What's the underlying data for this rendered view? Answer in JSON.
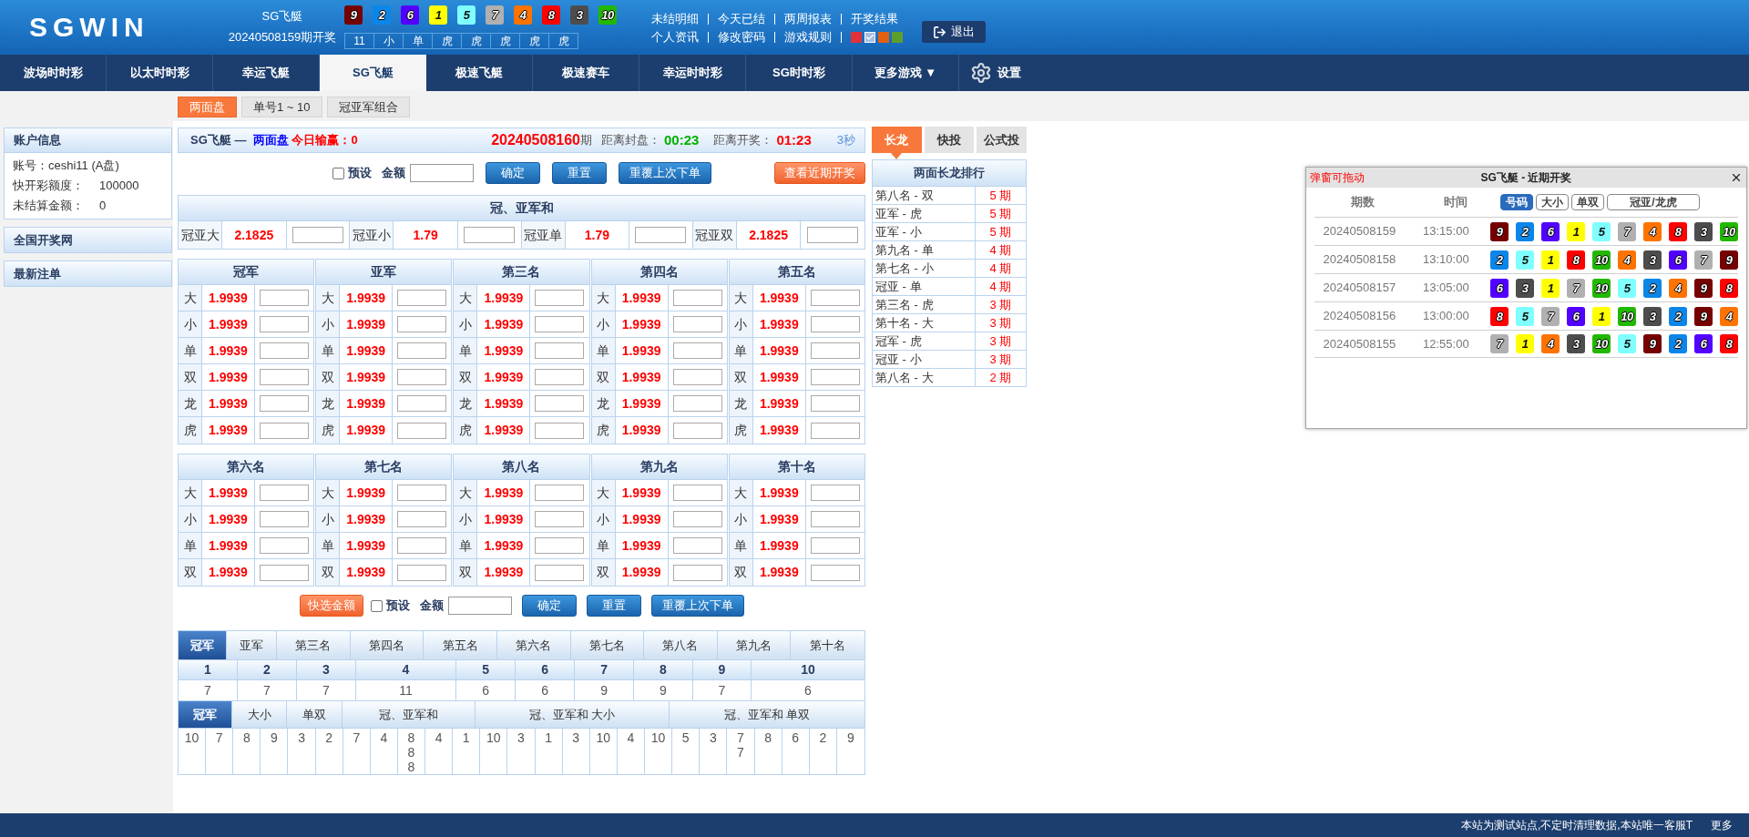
{
  "header": {
    "logo": "SGWIN",
    "game": "SG飞艇",
    "draw_label": "20240508159期开奖",
    "balls": [
      {
        "number": "9",
        "color": "#760000"
      },
      {
        "number": "2",
        "color": "#0b86e8"
      },
      {
        "number": "6",
        "color": "#5200ff"
      },
      {
        "number": "1",
        "color": "#ffff00"
      },
      {
        "number": "5",
        "color": "#80ffff"
      },
      {
        "number": "7",
        "color": "#b0b0b0"
      },
      {
        "number": "4",
        "color": "#ff7300"
      },
      {
        "number": "8",
        "color": "#ff0000"
      },
      {
        "number": "3",
        "color": "#4d4d4d"
      },
      {
        "number": "10",
        "color": "#22b800"
      }
    ],
    "stats": [
      "11",
      "小",
      "单",
      "虎",
      "虎",
      "虎",
      "虎",
      "虎"
    ],
    "links_row_1": [
      "未结明细",
      "今天已结",
      "两周报表",
      "开奖结果"
    ],
    "links_row_2": [
      "个人资讯",
      "修改密码",
      "游戏规则"
    ],
    "themes": [
      {
        "color": "#e0323a",
        "selected": false
      },
      {
        "color": "#a8c0e0",
        "selected": true
      },
      {
        "color": "#e0600f",
        "selected": false
      },
      {
        "color": "#5e9e2c",
        "selected": false
      }
    ],
    "logout": "退出"
  },
  "nav": {
    "items": [
      {
        "label": "波场时时彩",
        "selected": false
      },
      {
        "label": "以太时时彩",
        "selected": false
      },
      {
        "label": "幸运飞艇",
        "selected": false
      },
      {
        "label": "SG飞艇",
        "selected": true
      },
      {
        "label": "极速飞艇",
        "selected": false
      },
      {
        "label": "极速赛车",
        "selected": false
      },
      {
        "label": "幸运时时彩",
        "selected": false
      },
      {
        "label": "SG时时彩",
        "selected": false
      },
      {
        "label": "更多游戏 ▼",
        "selected": false
      }
    ],
    "settings": "设置"
  },
  "subtabs": [
    {
      "label": "两面盘",
      "selected": true
    },
    {
      "label": "单号1 ~ 10",
      "selected": false
    },
    {
      "label": "冠亚军组合",
      "selected": false
    }
  ],
  "sidebar": {
    "account": {
      "title": "账户信息",
      "rows": [
        {
          "kind": "text",
          "label": "账号：",
          "value": "ceshi11 (A盘)"
        },
        {
          "kind": "amount",
          "label": "快开彩额度：",
          "value": "100000"
        },
        {
          "kind": "amount",
          "label": "未结算金额：",
          "value": "0"
        }
      ]
    },
    "panels": [
      "全国开奖网",
      "最新注单"
    ]
  },
  "title_bar": {
    "game": "SG飞艇 —",
    "mode": "两面盘",
    "today_result": "今日输赢：0",
    "period": "20240508160",
    "period_suffix": "期",
    "close_label": "距离封盘：",
    "close_time": "00:23",
    "draw_label": "距离开奖：",
    "draw_time": "01:23",
    "refresh": "3秒"
  },
  "controls_top": {
    "preset_label": "预设",
    "preset_checked": false,
    "amount_label": "金额",
    "buttons": [
      "确定",
      "重置",
      "重覆上次下单"
    ],
    "recent_button": "查看近期开奖"
  },
  "sum_table": {
    "title": "冠、亚军和",
    "items": [
      {
        "label": "冠亚大",
        "odds": "2.1825"
      },
      {
        "label": "冠亚小",
        "odds": "1.79"
      },
      {
        "label": "冠亚单",
        "odds": "1.79"
      },
      {
        "label": "冠亚双",
        "odds": "2.1825"
      }
    ]
  },
  "positions_1": [
    {
      "title": "冠军",
      "rows": [
        {
          "label": "大",
          "odds": "1.9939"
        },
        {
          "label": "小",
          "odds": "1.9939"
        },
        {
          "label": "单",
          "odds": "1.9939"
        },
        {
          "label": "双",
          "odds": "1.9939"
        },
        {
          "label": "龙",
          "odds": "1.9939"
        },
        {
          "label": "虎",
          "odds": "1.9939"
        }
      ]
    },
    {
      "title": "亚军",
      "rows": [
        {
          "label": "大",
          "odds": "1.9939"
        },
        {
          "label": "小",
          "odds": "1.9939"
        },
        {
          "label": "单",
          "odds": "1.9939"
        },
        {
          "label": "双",
          "odds": "1.9939"
        },
        {
          "label": "龙",
          "odds": "1.9939"
        },
        {
          "label": "虎",
          "odds": "1.9939"
        }
      ]
    },
    {
      "title": "第三名",
      "rows": [
        {
          "label": "大",
          "odds": "1.9939"
        },
        {
          "label": "小",
          "odds": "1.9939"
        },
        {
          "label": "单",
          "odds": "1.9939"
        },
        {
          "label": "双",
          "odds": "1.9939"
        },
        {
          "label": "龙",
          "odds": "1.9939"
        },
        {
          "label": "虎",
          "odds": "1.9939"
        }
      ]
    },
    {
      "title": "第四名",
      "rows": [
        {
          "label": "大",
          "odds": "1.9939"
        },
        {
          "label": "小",
          "odds": "1.9939"
        },
        {
          "label": "单",
          "odds": "1.9939"
        },
        {
          "label": "双",
          "odds": "1.9939"
        },
        {
          "label": "龙",
          "odds": "1.9939"
        },
        {
          "label": "虎",
          "odds": "1.9939"
        }
      ]
    },
    {
      "title": "第五名",
      "rows": [
        {
          "label": "大",
          "odds": "1.9939"
        },
        {
          "label": "小",
          "odds": "1.9939"
        },
        {
          "label": "单",
          "odds": "1.9939"
        },
        {
          "label": "双",
          "odds": "1.9939"
        },
        {
          "label": "龙",
          "odds": "1.9939"
        },
        {
          "label": "虎",
          "odds": "1.9939"
        }
      ]
    }
  ],
  "positions_2": [
    {
      "title": "第六名",
      "rows": [
        {
          "label": "大",
          "odds": "1.9939"
        },
        {
          "label": "小",
          "odds": "1.9939"
        },
        {
          "label": "单",
          "odds": "1.9939"
        },
        {
          "label": "双",
          "odds": "1.9939"
        }
      ]
    },
    {
      "title": "第七名",
      "rows": [
        {
          "label": "大",
          "odds": "1.9939"
        },
        {
          "label": "小",
          "odds": "1.9939"
        },
        {
          "label": "单",
          "odds": "1.9939"
        },
        {
          "label": "双",
          "odds": "1.9939"
        }
      ]
    },
    {
      "title": "第八名",
      "rows": [
        {
          "label": "大",
          "odds": "1.9939"
        },
        {
          "label": "小",
          "odds": "1.9939"
        },
        {
          "label": "单",
          "odds": "1.9939"
        },
        {
          "label": "双",
          "odds": "1.9939"
        }
      ]
    },
    {
      "title": "第九名",
      "rows": [
        {
          "label": "大",
          "odds": "1.9939"
        },
        {
          "label": "小",
          "odds": "1.9939"
        },
        {
          "label": "单",
          "odds": "1.9939"
        },
        {
          "label": "双",
          "odds": "1.9939"
        }
      ]
    },
    {
      "title": "第十名",
      "rows": [
        {
          "label": "大",
          "odds": "1.9939"
        },
        {
          "label": "小",
          "odds": "1.9939"
        },
        {
          "label": "单",
          "odds": "1.9939"
        },
        {
          "label": "双",
          "odds": "1.9939"
        }
      ]
    }
  ],
  "controls_bottom": {
    "quick_button": "快选金额",
    "preset_label": "预设",
    "preset_checked": false,
    "amount_label": "金额",
    "buttons": [
      "确定",
      "重置",
      "重覆上次下单"
    ]
  },
  "stats": {
    "position_tabs": [
      {
        "label": "冠军",
        "selected": true
      },
      {
        "label": "亚军",
        "selected": false
      },
      {
        "label": "第三名",
        "selected": false
      },
      {
        "label": "第四名",
        "selected": false
      },
      {
        "label": "第五名",
        "selected": false
      },
      {
        "label": "第六名",
        "selected": false
      },
      {
        "label": "第七名",
        "selected": false
      },
      {
        "label": "第八名",
        "selected": false
      },
      {
        "label": "第九名",
        "selected": false
      },
      {
        "label": "第十名",
        "selected": false
      }
    ],
    "numbers": [
      "1",
      "2",
      "3",
      "4",
      "5",
      "6",
      "7",
      "8",
      "9",
      "10"
    ],
    "counts": [
      "7",
      "7",
      "7",
      "11",
      "6",
      "6",
      "9",
      "9",
      "7",
      "6"
    ],
    "trend_tabs": [
      {
        "label": "冠军",
        "selected": true
      },
      {
        "label": "大小",
        "selected": false
      },
      {
        "label": "单双",
        "selected": false
      },
      {
        "label": "冠、亚军和",
        "selected": false
      },
      {
        "label": "冠、亚军和 大小",
        "selected": false
      },
      {
        "label": "冠、亚军和 单双",
        "selected": false
      }
    ],
    "trend_columns": [
      [
        "10"
      ],
      [
        "7"
      ],
      [
        "8"
      ],
      [
        "9"
      ],
      [
        "3"
      ],
      [
        "2"
      ],
      [
        "7"
      ],
      [
        "4"
      ],
      [
        "8",
        "8",
        "8"
      ],
      [
        "4"
      ],
      [
        "1"
      ],
      [
        "10"
      ],
      [
        "3"
      ],
      [
        "1"
      ],
      [
        "3"
      ],
      [
        "10"
      ],
      [
        "4"
      ],
      [
        "10"
      ],
      [
        "5"
      ],
      [
        "3"
      ],
      [
        "7",
        "7"
      ],
      [
        "8"
      ],
      [
        "6"
      ],
      [
        "2"
      ],
      [
        "9"
      ]
    ]
  },
  "long_dragon": {
    "tabs": [
      {
        "label": "长龙",
        "selected": true
      },
      {
        "label": "快投",
        "selected": false
      },
      {
        "label": "公式投",
        "selected": false
      }
    ],
    "title": "两面长龙排行",
    "rows": [
      {
        "label": "第八名 - 双",
        "count": "5 期"
      },
      {
        "label": "亚军 - 虎",
        "count": "5 期"
      },
      {
        "label": "亚军 - 小",
        "count": "5 期"
      },
      {
        "label": "第九名 - 单",
        "count": "4 期"
      },
      {
        "label": "第七名 - 小",
        "count": "4 期"
      },
      {
        "label": "冠亚 - 单",
        "count": "4 期"
      },
      {
        "label": "第三名 - 虎",
        "count": "3 期"
      },
      {
        "label": "第十名 - 大",
        "count": "3 期"
      },
      {
        "label": "冠军 - 虎",
        "count": "3 期"
      },
      {
        "label": "冠亚 - 小",
        "count": "3 期"
      },
      {
        "label": "第八名 - 大",
        "count": "2 期"
      }
    ]
  },
  "popup": {
    "hint": "弹窗可拖动",
    "title": "SG飞艇 - 近期开奖",
    "columns": [
      "期数",
      "时间"
    ],
    "tabs": [
      {
        "label": "号码",
        "selected": true
      },
      {
        "label": "大小",
        "selected": false
      },
      {
        "label": "单双",
        "selected": false
      },
      {
        "label": "冠亚/龙虎",
        "selected": false
      }
    ],
    "rows": [
      {
        "period": "20240508159",
        "time": "13:15:00",
        "balls": [
          {
            "number": "9",
            "color": "#760000"
          },
          {
            "number": "2",
            "color": "#0b86e8"
          },
          {
            "number": "6",
            "color": "#5200ff"
          },
          {
            "number": "1",
            "color": "#ffff00"
          },
          {
            "number": "5",
            "color": "#80ffff"
          },
          {
            "number": "7",
            "color": "#b0b0b0"
          },
          {
            "number": "4",
            "color": "#ff7300"
          },
          {
            "number": "8",
            "color": "#ff0000"
          },
          {
            "number": "3",
            "color": "#4d4d4d"
          },
          {
            "number": "10",
            "color": "#22b800"
          }
        ]
      },
      {
        "period": "20240508158",
        "time": "13:10:00",
        "balls": [
          {
            "number": "2",
            "color": "#0b86e8"
          },
          {
            "number": "5",
            "color": "#80ffff"
          },
          {
            "number": "1",
            "color": "#ffff00"
          },
          {
            "number": "8",
            "color": "#ff0000"
          },
          {
            "number": "10",
            "color": "#22b800"
          },
          {
            "number": "4",
            "color": "#ff7300"
          },
          {
            "number": "3",
            "color": "#4d4d4d"
          },
          {
            "number": "6",
            "color": "#5200ff"
          },
          {
            "number": "7",
            "color": "#b0b0b0"
          },
          {
            "number": "9",
            "color": "#760000"
          }
        ]
      },
      {
        "period": "20240508157",
        "time": "13:05:00",
        "balls": [
          {
            "number": "6",
            "color": "#5200ff"
          },
          {
            "number": "3",
            "color": "#4d4d4d"
          },
          {
            "number": "1",
            "color": "#ffff00"
          },
          {
            "number": "7",
            "color": "#b0b0b0"
          },
          {
            "number": "10",
            "color": "#22b800"
          },
          {
            "number": "5",
            "color": "#80ffff"
          },
          {
            "number": "2",
            "color": "#0b86e8"
          },
          {
            "number": "4",
            "color": "#ff7300"
          },
          {
            "number": "9",
            "color": "#760000"
          },
          {
            "number": "8",
            "color": "#ff0000"
          }
        ]
      },
      {
        "period": "20240508156",
        "time": "13:00:00",
        "balls": [
          {
            "number": "8",
            "color": "#ff0000"
          },
          {
            "number": "5",
            "color": "#80ffff"
          },
          {
            "number": "7",
            "color": "#b0b0b0"
          },
          {
            "number": "6",
            "color": "#5200ff"
          },
          {
            "number": "1",
            "color": "#ffff00"
          },
          {
            "number": "10",
            "color": "#22b800"
          },
          {
            "number": "3",
            "color": "#4d4d4d"
          },
          {
            "number": "2",
            "color": "#0b86e8"
          },
          {
            "number": "9",
            "color": "#760000"
          },
          {
            "number": "4",
            "color": "#ff7300"
          }
        ]
      },
      {
        "period": "20240508155",
        "time": "12:55:00",
        "balls": [
          {
            "number": "7",
            "color": "#b0b0b0"
          },
          {
            "number": "1",
            "color": "#ffff00"
          },
          {
            "number": "4",
            "color": "#ff7300"
          },
          {
            "number": "3",
            "color": "#4d4d4d"
          },
          {
            "number": "10",
            "color": "#22b800"
          },
          {
            "number": "5",
            "color": "#80ffff"
          },
          {
            "number": "9",
            "color": "#760000"
          },
          {
            "number": "2",
            "color": "#0b86e8"
          },
          {
            "number": "6",
            "color": "#5200ff"
          },
          {
            "number": "8",
            "color": "#ff0000"
          }
        ]
      }
    ]
  },
  "footer": {
    "notice": "本站为测试站点,不定时清理数据,本站唯一客服T",
    "more": "更多"
  }
}
